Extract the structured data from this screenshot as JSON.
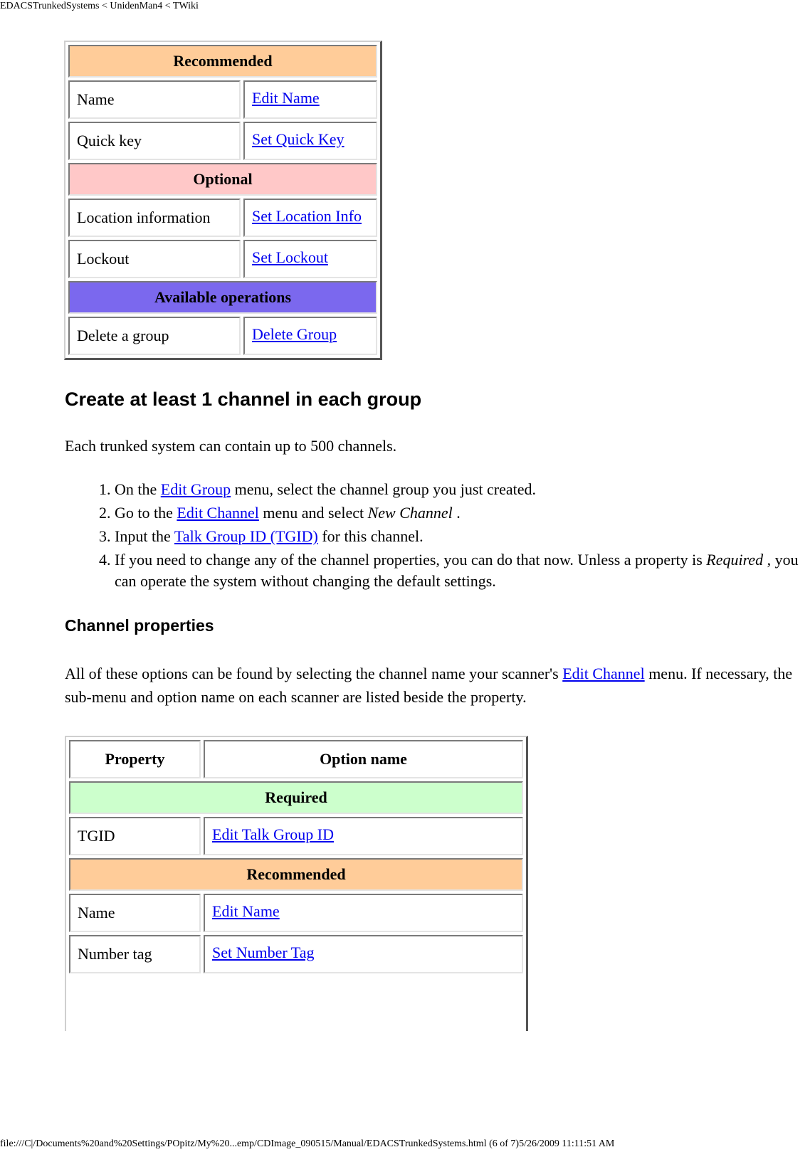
{
  "page_header": "EDACSTrunkedSystems < UnidenMan4 < TWiki",
  "group_table": {
    "sections": [
      {
        "title": "Recommended",
        "color": "#ffcc99",
        "rows": [
          {
            "property": "Name",
            "option": "Edit Name"
          },
          {
            "property": "Quick key",
            "option": "Set Quick Key"
          }
        ]
      },
      {
        "title": "Optional",
        "color": "#ffc8c8",
        "rows": [
          {
            "property": "Location information",
            "option": "Set Location Info"
          },
          {
            "property": "Lockout",
            "option": "Set Lockout"
          }
        ]
      },
      {
        "title": "Available operations",
        "color": "#7b68ee",
        "rows": [
          {
            "property": "Delete a group",
            "option": "Delete Group"
          }
        ]
      }
    ]
  },
  "section_channel": {
    "heading": "Create at least 1 channel in each group",
    "intro": "Each trunked system can contain up to 500 channels.",
    "steps": [
      {
        "before": "On the ",
        "link": "Edit Group",
        "after": " menu, select the channel group you just created."
      },
      {
        "before": "Go to the ",
        "link": "Edit Channel",
        "after": " menu and select ",
        "italic": "New Channel",
        "tail": " ."
      },
      {
        "before": "Input the ",
        "link": "Talk Group ID (TGID)",
        "after": " for this channel."
      },
      {
        "before": "If you need to change any of the channel properties, you can do that now. Unless a property is ",
        "italic": "Required",
        "tail": " , you can operate the system without changing the default settings."
      }
    ]
  },
  "section_properties": {
    "heading": "Channel properties",
    "para_before": "All of these options can be found by selecting the channel name your scanner's ",
    "para_link": "Edit Channel",
    "para_after": " menu. If necessary, the sub-menu and option name on each scanner are listed beside the property."
  },
  "channel_table": {
    "col_property": "Property",
    "col_option": "Option name",
    "sections": [
      {
        "title": "Required",
        "color": "#ccffcc",
        "rows": [
          {
            "property": "TGID",
            "option": "Edit Talk Group ID"
          }
        ]
      },
      {
        "title": "Recommended",
        "color": "#ffcc99",
        "rows": [
          {
            "property": "Name",
            "option": "Edit Name"
          },
          {
            "property": "Number tag",
            "option": "Set Number Tag"
          }
        ]
      }
    ]
  },
  "page_footer": "file:///C|/Documents%20and%20Settings/POpitz/My%20...emp/CDImage_090515/Manual/EDACSTrunkedSystems.html (6 of 7)5/26/2009 11:11:51 AM"
}
